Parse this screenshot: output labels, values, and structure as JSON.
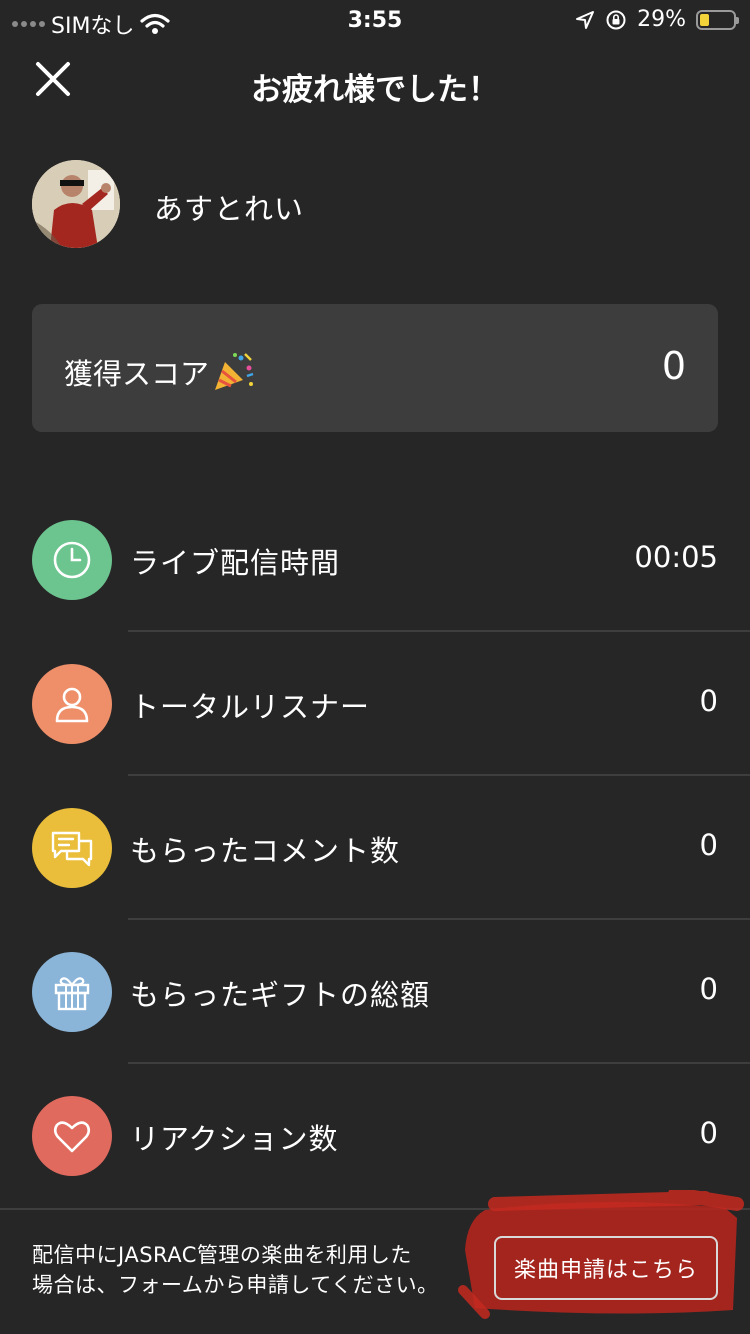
{
  "status_bar": {
    "carrier": "SIMなし",
    "time": "3:55",
    "battery": "29%",
    "battery_level": 0.29
  },
  "header": {
    "title": "お疲れ様でした！"
  },
  "user": {
    "name": "あすとれい"
  },
  "score": {
    "label": "獲得スコア",
    "value": "0"
  },
  "stats": [
    {
      "label": "ライブ配信時間",
      "value": "00:05",
      "icon": "clock-icon",
      "color": "#6cc48f"
    },
    {
      "label": "トータルリスナー",
      "value": "0",
      "icon": "person-icon",
      "color": "#ee8f6a"
    },
    {
      "label": "もらったコメント数",
      "value": "0",
      "icon": "chat-icon",
      "color": "#eabe3a"
    },
    {
      "label": "もらったギフトの総額",
      "value": "0",
      "icon": "gift-icon",
      "color": "#8ab4d8"
    },
    {
      "label": "リアクション数",
      "value": "0",
      "icon": "heart-icon",
      "color": "#e06a5e"
    }
  ],
  "footer": {
    "note_line1": "配信中にJASRAC管理の楽曲を利用した",
    "note_line2": "場合は、フォームから申請してください。",
    "button_label": "楽曲申請はこちら"
  }
}
